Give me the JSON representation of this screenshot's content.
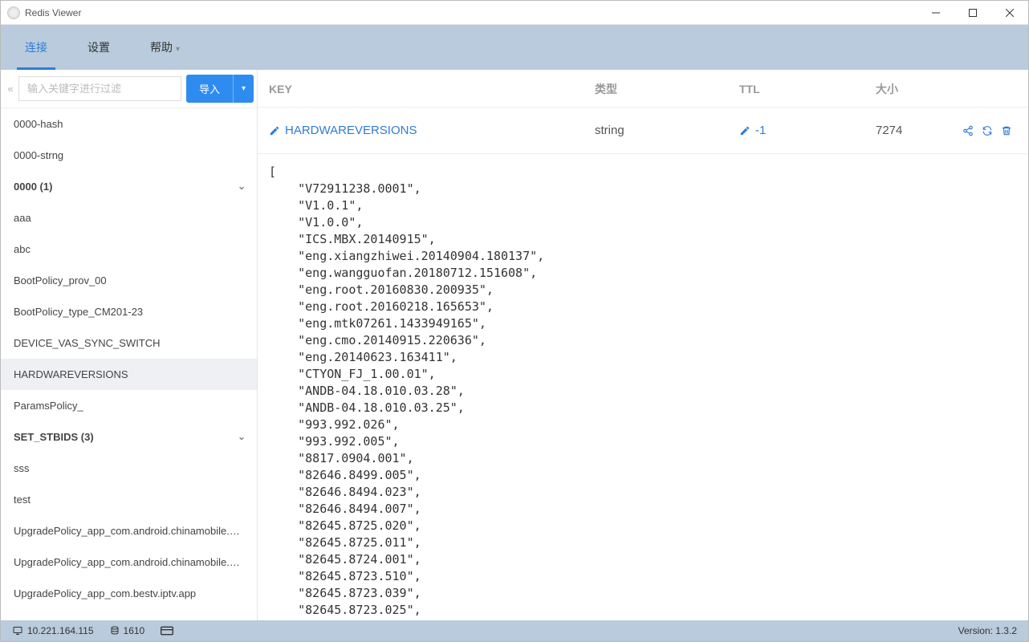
{
  "window": {
    "title": "Redis Viewer"
  },
  "menu": {
    "items": [
      {
        "label": "连接",
        "active": true
      },
      {
        "label": "设置",
        "active": false
      },
      {
        "label": "帮助",
        "active": false,
        "has_dropdown": true
      }
    ]
  },
  "sidebar": {
    "search_placeholder": "输入关键字进行过滤",
    "import_label": "导入",
    "keys": [
      {
        "label": "0000-hash",
        "group": false
      },
      {
        "label": "0000-strng",
        "group": false
      },
      {
        "label": "0000 (1)",
        "group": true,
        "expandable": true
      },
      {
        "label": "aaa",
        "group": false
      },
      {
        "label": "abc",
        "group": false
      },
      {
        "label": "BootPolicy_prov_00",
        "group": false
      },
      {
        "label": "BootPolicy_type_CM201-23",
        "group": false
      },
      {
        "label": "DEVICE_VAS_SYNC_SWITCH",
        "group": false
      },
      {
        "label": "HARDWAREVERSIONS",
        "group": false,
        "selected": true
      },
      {
        "label": "ParamsPolicy_",
        "group": false
      },
      {
        "label": "SET_STBIDS (3)",
        "group": true,
        "expandable": true
      },
      {
        "label": "sss",
        "group": false
      },
      {
        "label": "test",
        "group": false
      },
      {
        "label": "UpgradePolicy_app_com.android.chinamobile.ch...",
        "group": false
      },
      {
        "label": "UpgradePolicy_app_com.android.chinamobile.mi...",
        "group": false
      },
      {
        "label": "UpgradePolicy_app_com.bestv.iptv.app",
        "group": false
      }
    ]
  },
  "detail": {
    "headers": {
      "key": "KEY",
      "type": "类型",
      "ttl": "TTL",
      "size": "大小"
    },
    "row": {
      "key": "HARDWAREVERSIONS",
      "type": "string",
      "ttl": "-1",
      "size": "7274"
    },
    "value_lines": [
      "[",
      "    \"V72911238.0001\",",
      "    \"V1.0.1\",",
      "    \"V1.0.0\",",
      "    \"ICS.MBX.20140915\",",
      "    \"eng.xiangzhiwei.20140904.180137\",",
      "    \"eng.wangguofan.20180712.151608\",",
      "    \"eng.root.20160830.200935\",",
      "    \"eng.root.20160218.165653\",",
      "    \"eng.mtk07261.1433949165\",",
      "    \"eng.cmo.20140915.220636\",",
      "    \"eng.20140623.163411\",",
      "    \"CTYON_FJ_1.00.01\",",
      "    \"ANDB-04.18.010.03.28\",",
      "    \"ANDB-04.18.010.03.25\",",
      "    \"993.992.026\",",
      "    \"993.992.005\",",
      "    \"8817.0904.001\",",
      "    \"82646.8499.005\",",
      "    \"82646.8494.023\",",
      "    \"82646.8494.007\",",
      "    \"82645.8725.020\",",
      "    \"82645.8725.011\",",
      "    \"82645.8724.001\",",
      "    \"82645.8723.510\",",
      "    \"82645.8723.039\",",
      "    \"82645.8723.025\","
    ]
  },
  "status": {
    "host": "10.221.164.115",
    "db_count": "1610",
    "version": "Version: 1.3.2"
  }
}
